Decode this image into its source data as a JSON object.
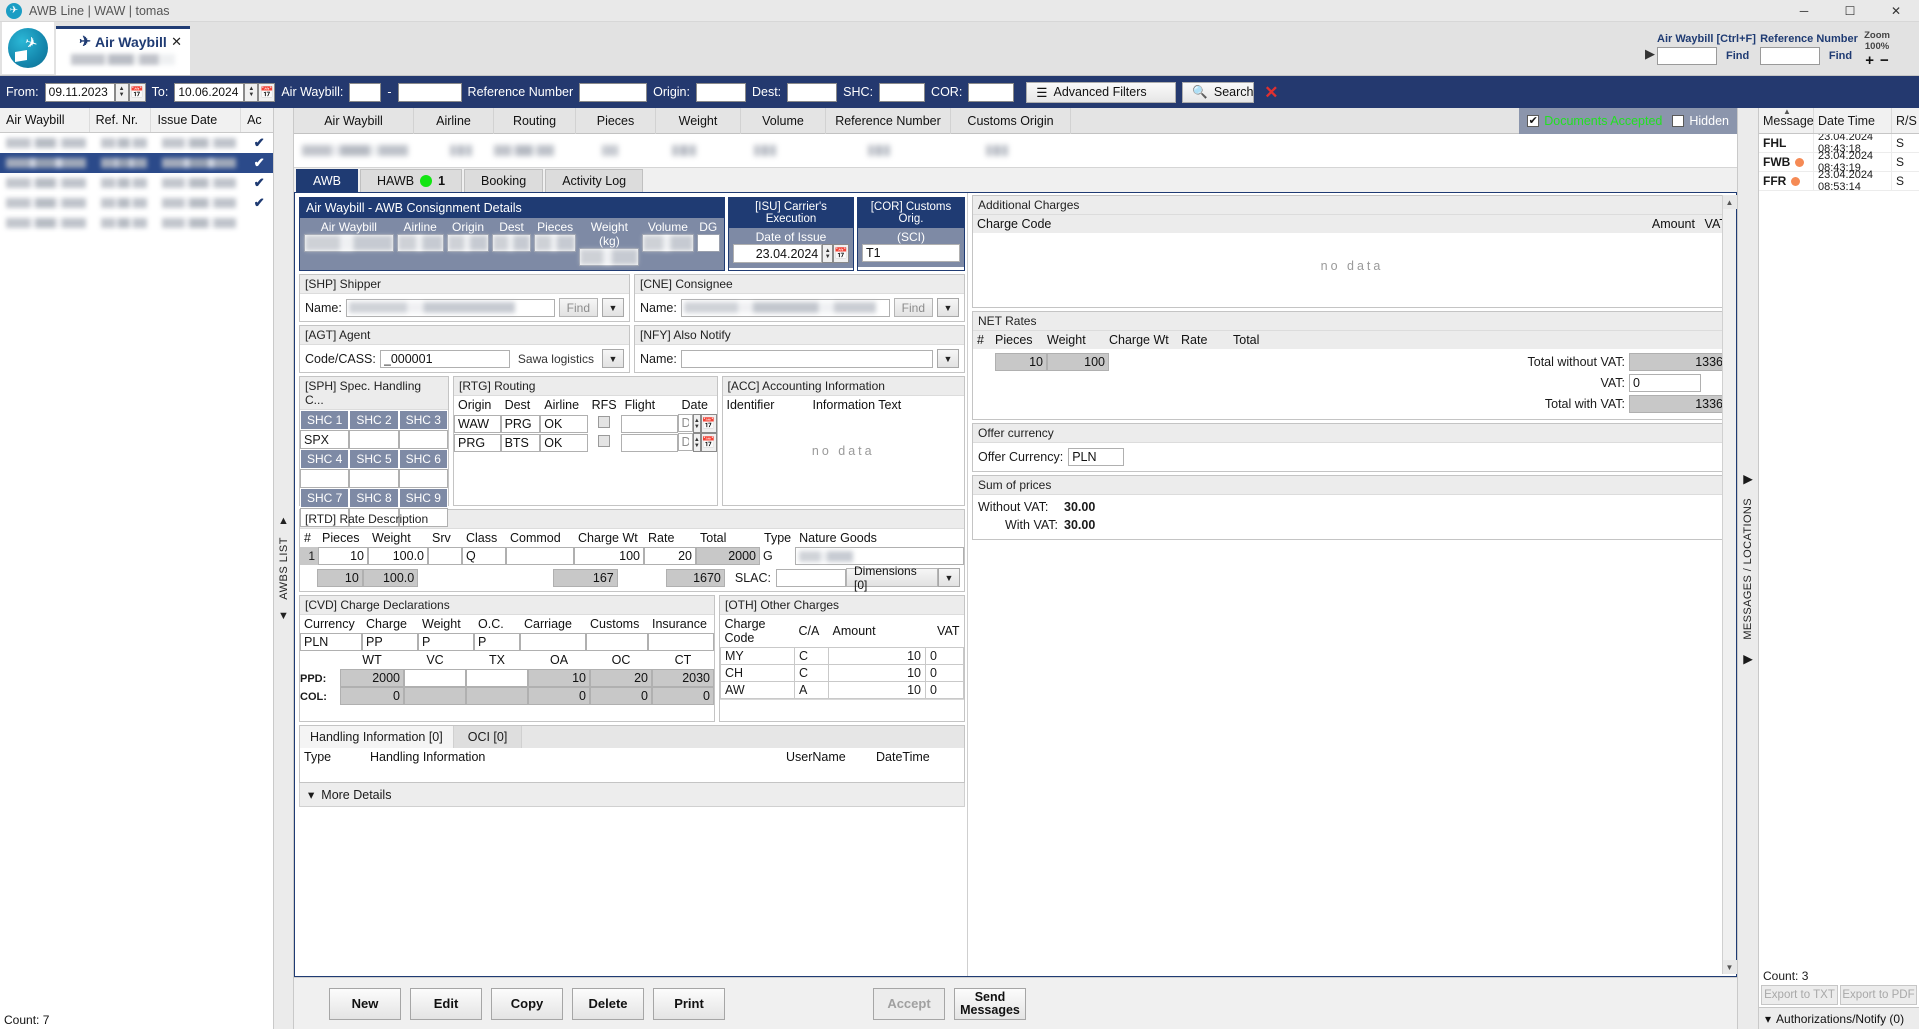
{
  "window": {
    "title": "AWB Line | WAW | tomas",
    "logo_icon": "airplane-circle-logo",
    "minimize": "─",
    "maximize": "☐",
    "close": "✕"
  },
  "tab": {
    "label": "Air Waybill",
    "plane_icon": "airplane-icon",
    "close_icon": "✕",
    "subtitle_redacted": ""
  },
  "header_find": {
    "awb_label": "Air Waybill [Ctrl+F]",
    "awb_value": "",
    "awb_find": "Find",
    "ref_label": "Reference Number",
    "ref_value": "",
    "ref_find": "Find",
    "zoom_label": "Zoom",
    "zoom_value": "100%",
    "zoom_in": "+",
    "zoom_out": "−"
  },
  "filterbar": {
    "from_label": "From:",
    "from_value": "09.11.2023",
    "to_label": "To:",
    "to_value": "10.06.2024",
    "awb_label": "Air Waybill:",
    "awb_prefix": "",
    "awb_dash": "-",
    "awb_serial": "",
    "ref_label": "Reference Number",
    "ref_value": "",
    "origin_label": "Origin:",
    "origin_value": "",
    "dest_label": "Dest:",
    "dest_value": "",
    "shc_label": "SHC:",
    "shc_value": "",
    "cor_label": "COR:",
    "cor_value": "",
    "advanced_filters": "Advanced Filters",
    "search": "Search",
    "clear_icon": "✕"
  },
  "left_list": {
    "columns": [
      "Air Waybill",
      "Ref. Nr.",
      "Issue Date",
      "Ac"
    ],
    "rows": [
      {
        "redacted": true,
        "checked": true,
        "selected": false
      },
      {
        "redacted": true,
        "checked": true,
        "selected": true
      },
      {
        "redacted": true,
        "checked": true,
        "selected": false
      },
      {
        "redacted": true,
        "checked": true,
        "selected": false
      },
      {
        "redacted": true,
        "checked": false,
        "selected": false
      }
    ],
    "count_label": "Count: 7",
    "strip_label": "AWBS LIST"
  },
  "grid": {
    "columns": [
      "Air Waybill",
      "Airline",
      "Routing",
      "Pieces",
      "Weight",
      "Volume",
      "Reference Number",
      "Customs Origin"
    ],
    "documents_accepted_label": "Documents Accepted",
    "documents_accepted_checked": true,
    "hidden_label": "Hidden",
    "hidden_checked": false
  },
  "subtabs": [
    {
      "label": "AWB",
      "active": true
    },
    {
      "label": "HAWB",
      "badge": "1",
      "dot": "green",
      "active": false
    },
    {
      "label": "Booking",
      "active": false
    },
    {
      "label": "Activity Log",
      "active": false
    }
  ],
  "consignment": {
    "title": "Air Waybill - AWB Consignment Details",
    "columns": [
      "Air Waybill",
      "Airline",
      "Origin",
      "Dest",
      "Pieces",
      "Weight (kg)",
      "Volume",
      "DG"
    ],
    "dg_value": ""
  },
  "isu": {
    "title": "[ISU] Carrier's Execution",
    "date_label": "Date of Issue",
    "date_value": "23.04.2024"
  },
  "cor": {
    "title": "[COR] Customs Orig.",
    "sci_label": "(SCI)",
    "sci_value": "T1"
  },
  "shipper": {
    "title": "[SHP] Shipper",
    "name_label": "Name:",
    "name_value": "",
    "find_label": "Find",
    "dropdown_icon": "chevron-down-icon"
  },
  "consignee": {
    "title": "[CNE] Consignee",
    "name_label": "Name:",
    "name_value": "",
    "find_label": "Find",
    "dropdown_icon": "chevron-down-icon"
  },
  "agent": {
    "title": "[AGT] Agent",
    "code_label": "Code/CASS:",
    "code_value": "_000001",
    "agent_name": "Sawa logistics",
    "dropdown_icon": "chevron-down-icon"
  },
  "also_notify": {
    "title": "[NFY] Also Notify",
    "name_label": "Name:",
    "name_value": "",
    "dropdown_icon": "chevron-down-icon"
  },
  "sph": {
    "title": "[SPH] Spec. Handling C...",
    "labels": [
      "SHC 1",
      "SHC 2",
      "SHC 3",
      "SHC 4",
      "SHC 5",
      "SHC 6",
      "SHC 7",
      "SHC 8",
      "SHC 9"
    ],
    "values": [
      "SPX",
      "",
      "",
      "",
      "",
      "",
      "",
      "",
      ""
    ]
  },
  "routing": {
    "title": "[RTG] Routing",
    "columns": [
      "Origin",
      "Dest",
      "Airline",
      "RFS",
      "Flight",
      "Date"
    ],
    "rows": [
      {
        "origin": "WAW",
        "dest": "PRG",
        "airline": "OK",
        "rfs": false,
        "flight": "",
        "date": "Date"
      },
      {
        "origin": "PRG",
        "dest": "BTS",
        "airline": "OK",
        "rfs": false,
        "flight": "",
        "date": "Date"
      }
    ]
  },
  "acc": {
    "title": "[ACC] Accounting Information",
    "columns": [
      "Identifier",
      "Information Text"
    ],
    "empty_text": "no data"
  },
  "rtd": {
    "title": "[RTD] Rate Description",
    "columns": [
      "#",
      "Pieces",
      "Weight",
      "Srv",
      "Class",
      "Commod",
      "Charge Wt",
      "Rate",
      "Total",
      "Type",
      "Nature Goods"
    ],
    "rows": [
      {
        "num": "1",
        "pieces": "10",
        "weight": "100.0",
        "srv": "",
        "class": "Q",
        "commod": "",
        "charge_wt": "100",
        "rate": "20",
        "total": "2000",
        "type": "G",
        "nature_goods": ""
      }
    ],
    "totals": {
      "pieces": "10",
      "weight": "100.0",
      "charge_wt": "167",
      "total": "1670"
    },
    "slac_label": "SLAC:",
    "slac_value": "",
    "dimensions_label": "Dimensions [0]"
  },
  "cvd": {
    "title": "[CVD] Charge Declarations",
    "columns": [
      "Currency",
      "Charge",
      "Weight",
      "O.C.",
      "Carriage",
      "Customs",
      "Insurance"
    ],
    "values": [
      "PLN",
      "PP",
      "P",
      "P",
      "",
      "",
      ""
    ],
    "sub_columns": [
      "",
      "WT",
      "VC",
      "TX",
      "OA",
      "OC",
      "CT"
    ],
    "ppd_label": "PPD:",
    "ppd_values": [
      "2000",
      "",
      "",
      "10",
      "20",
      "2030"
    ],
    "col_label": "COL:",
    "col_values": [
      "0",
      "",
      "",
      "0",
      "0",
      "0"
    ]
  },
  "oth": {
    "title": "[OTH] Other Charges",
    "columns": [
      "Charge Code",
      "C/A",
      "Amount",
      "VAT"
    ],
    "rows": [
      {
        "code": "MY",
        "ca": "C",
        "amount": "10",
        "vat": "0"
      },
      {
        "code": "CH",
        "ca": "C",
        "amount": "10",
        "vat": "0"
      },
      {
        "code": "AW",
        "ca": "A",
        "amount": "10",
        "vat": "0"
      }
    ]
  },
  "handling": {
    "tabs": [
      {
        "label": "Handling Information [0]",
        "active": true
      },
      {
        "label": "OCI [0]",
        "active": false
      }
    ],
    "columns": [
      "Type",
      "Handling Information",
      "UserName",
      "DateTime"
    ]
  },
  "more_details": {
    "label": "More Details",
    "icon": "chevron-down-icon"
  },
  "additional_charges": {
    "title": "Additional Charges",
    "columns": [
      "Charge Code",
      "Amount",
      "VAT"
    ],
    "empty_text": "no data"
  },
  "net_rates": {
    "title": "NET Rates",
    "columns": [
      "#",
      "Pieces",
      "Weight",
      "Charge Wt",
      "Rate",
      "Total"
    ],
    "pieces": "10",
    "weight": "100",
    "total_without_vat_label": "Total without VAT:",
    "total_without_vat": "1336",
    "vat_label": "VAT:",
    "vat": "0",
    "total_with_vat_label": "Total with VAT:",
    "total_with_vat": "1336"
  },
  "offer_currency": {
    "title": "Offer currency",
    "label": "Offer Currency:",
    "value": "PLN"
  },
  "sum_of_prices": {
    "title": "Sum of prices",
    "without_vat_label": "Without VAT:",
    "without_vat": "30.00",
    "with_vat_label": "With VAT:",
    "with_vat": "30.00"
  },
  "buttons": {
    "new": "New",
    "edit": "Edit",
    "copy": "Copy",
    "delete": "Delete",
    "print": "Print",
    "accept": "Accept",
    "send_line1": "Send",
    "send_line2": "Messages"
  },
  "messages": {
    "strip_label": "MESSAGES / LOCATIONS",
    "columns": [
      "Message",
      "Date Time",
      "R/S"
    ],
    "sort_icon": "sort-asc-icon",
    "rows": [
      {
        "message": "FHL",
        "dot": false,
        "datetime": "23.04.2024 08:43:18",
        "rs": "S"
      },
      {
        "message": "FWB",
        "dot": true,
        "datetime": "23.04.2024 08:43:19",
        "rs": "S"
      },
      {
        "message": "FFR",
        "dot": true,
        "datetime": "23.04.2024 08:53:14",
        "rs": "S"
      }
    ],
    "count_label": "Count: 3",
    "export_txt": "Export to TXT",
    "export_pdf": "Export to PDF",
    "auth_label": "Authorizations/Notify (0)",
    "auth_icon": "chevron-down-icon"
  }
}
